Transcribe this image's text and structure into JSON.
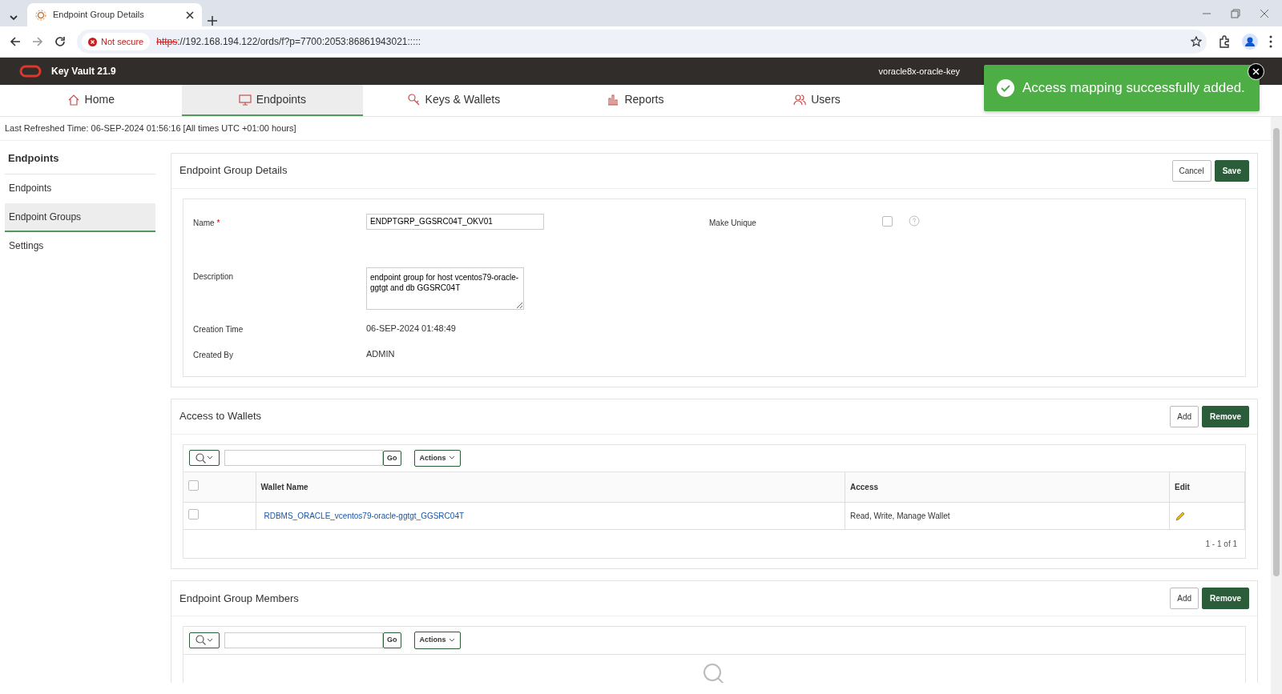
{
  "browser": {
    "tab_title": "Endpoint Group Details",
    "security": "Not secure",
    "url_scheme": "https",
    "url_rest": "://192.168.194.122/ords/f?p=7700:2053:86861943021:::::"
  },
  "app": {
    "title": "Key Vault 21.9",
    "host": "voracle8x-oracle-key"
  },
  "nav_tabs": [
    {
      "label": "Home",
      "selected": false
    },
    {
      "label": "Endpoints",
      "selected": true
    },
    {
      "label": "Keys & Wallets",
      "selected": false
    },
    {
      "label": "Reports",
      "selected": false
    },
    {
      "label": "Users",
      "selected": false
    }
  ],
  "refresh": "Last Refreshed Time: 06-SEP-2024 01:56:16 [All times UTC +01:00 hours]",
  "sidebar": {
    "title": "Endpoints",
    "items": [
      {
        "label": "Endpoints",
        "selected": false
      },
      {
        "label": "Endpoint Groups",
        "selected": true
      },
      {
        "label": "Settings",
        "selected": false
      }
    ]
  },
  "details": {
    "title": "Endpoint Group Details",
    "cancel": "Cancel",
    "save": "Save",
    "name_label": "Name",
    "required_mark": "*",
    "name_value": "ENDPTGRP_GGSRC04T_OKV01",
    "make_unique_label": "Make Unique",
    "make_unique_checked": false,
    "description_label": "Description",
    "description_value": "endpoint group for host vcentos79-oracle-ggtgt and db GGSRC04T",
    "creation_label": "Creation Time",
    "creation_value": "06-SEP-2024 01:48:49",
    "created_by_label": "Created By",
    "created_by_value": "ADMIN"
  },
  "wallets": {
    "title": "Access to Wallets",
    "add": "Add",
    "remove": "Remove",
    "go": "Go",
    "actions": "Actions",
    "select_all_checked": false,
    "columns": [
      "Wallet Name",
      "Access",
      "Edit"
    ],
    "rows": [
      {
        "checked": false,
        "wallet": "RDBMS_ORACLE_vcentos79-oracle-ggtgt_GGSRC04T",
        "access": "Read, Write, Manage Wallet"
      }
    ],
    "pagination": "1 - 1 of 1"
  },
  "members": {
    "title": "Endpoint Group Members",
    "add": "Add",
    "remove": "Remove",
    "go": "Go",
    "actions": "Actions"
  },
  "toast": {
    "message": "Access mapping successfully added."
  }
}
